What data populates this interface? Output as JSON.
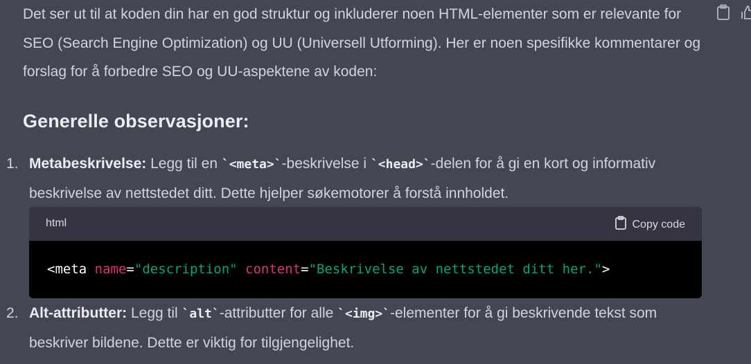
{
  "intro": {
    "text": "Det ser ut til at koden din har en god struktur og inkluderer noen HTML-elementer som er relevante for SEO (Search Engine Optimization) og UU (Universell Utforming). Her er noen spesifikke kommentarer og forslag for å forbedre SEO og UU-aspektene av koden:"
  },
  "heading": "Generelle observasjoner:",
  "items": [
    {
      "number": "1.",
      "title": "Metabeskrivelse:",
      "t1": " Legg til en ",
      "code1": "`<meta>`",
      "t2": "-beskrivelse i ",
      "code2": "`<head>`",
      "t3": "-delen for å gi en kort og informativ beskrivelse av nettstedet ditt. Dette hjelper søkemotorer å forstå innholdet."
    },
    {
      "number": "2.",
      "title": "Alt-attributter:",
      "t1": " Legg til ",
      "code1": "`alt`",
      "t2": "-attributter for alle ",
      "code2": "`<img>`",
      "t3": "-elementer for å gi beskrivende tekst som beskriver bildene. Dette er viktig for tilgjengelighet."
    }
  ],
  "codeblock": {
    "language": "html",
    "copy_label": "Copy code",
    "tag_open": "<meta",
    "attr1": "name",
    "eq": "=",
    "str1": "\"description\"",
    "attr2": "content",
    "str2": "\"Beskrivelse av nettstedet ditt her.\"",
    "tag_close": ">"
  }
}
